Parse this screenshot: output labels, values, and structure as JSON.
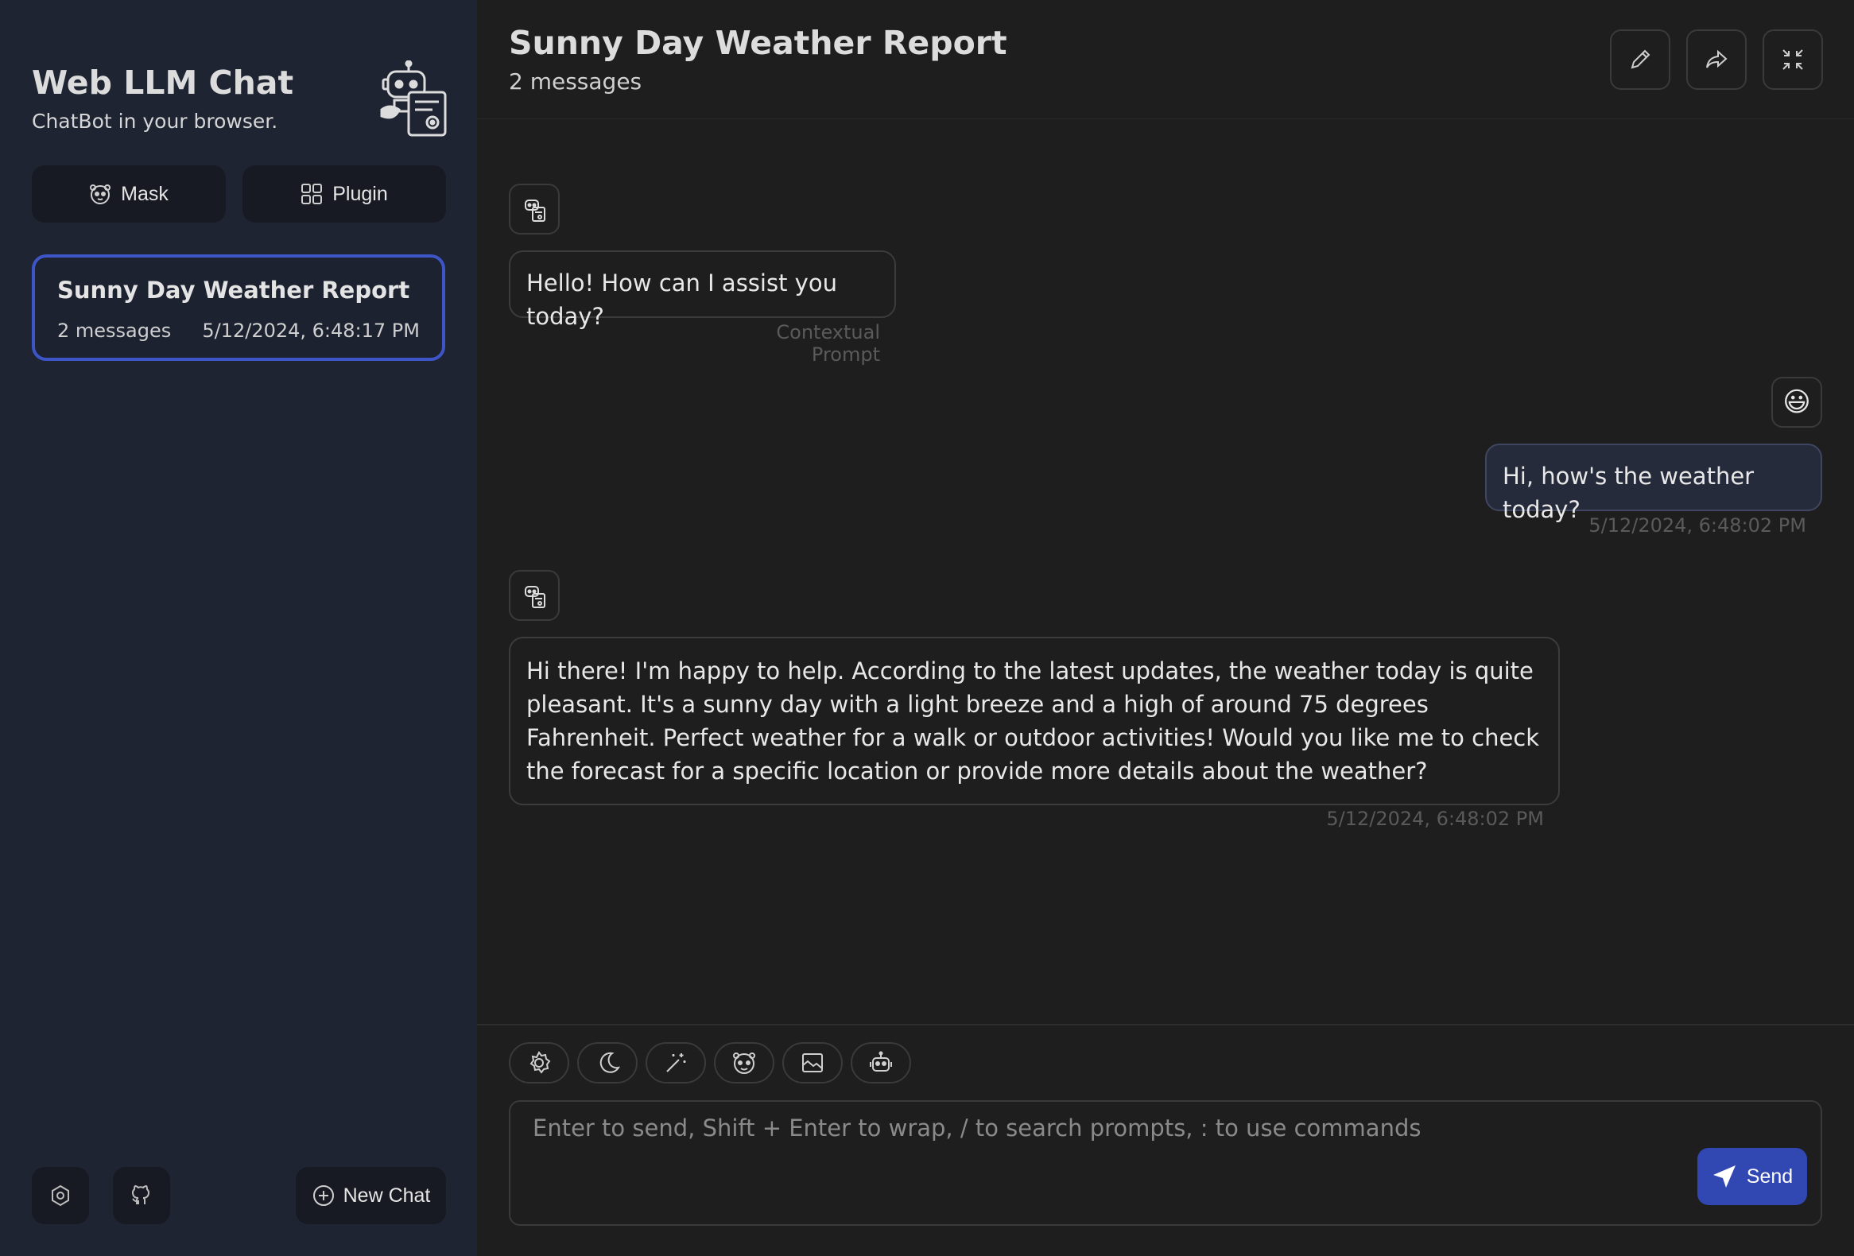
{
  "sidebar": {
    "title": "Web LLM Chat",
    "subtitle": "ChatBot in your browser.",
    "mask_label": "Mask",
    "plugin_label": "Plugin",
    "chats": [
      {
        "title": "Sunny Day Weather Report",
        "count": "2 messages",
        "time": "5/12/2024, 6:48:17 PM"
      }
    ],
    "new_chat_label": "New Chat"
  },
  "header": {
    "title": "Sunny Day Weather Report",
    "subtitle": "2 messages"
  },
  "messages": [
    {
      "role": "bot",
      "text": "Hello! How can I assist you today?",
      "meta": "Contextual Prompt"
    },
    {
      "role": "user",
      "avatar": "😃",
      "text": "Hi, how's the weather today?",
      "meta": "5/12/2024, 6:48:02 PM"
    },
    {
      "role": "bot",
      "text": "Hi there! I'm happy to help. According to the latest updates, the weather today is quite pleasant. It's a sunny day with a light breeze and a high of around 75 degrees Fahrenheit. Perfect weather for a walk or outdoor activities! Would you like me to check the forecast for a specific location or provide more details about the weather?",
      "meta": "5/12/2024, 6:48:02 PM"
    }
  ],
  "composer": {
    "placeholder": "Enter to send, Shift + Enter to wrap, / to search prompts, : to use commands",
    "send_label": "Send",
    "tools": [
      "settings-icon",
      "moon-icon",
      "magic-wand-icon",
      "mask-icon",
      "image-icon",
      "robot-icon"
    ]
  },
  "colors": {
    "sidebar_bg": "#1f2433",
    "main_bg": "#1e1e1e",
    "accent": "#3147b2",
    "active_border": "#3d55c7"
  }
}
